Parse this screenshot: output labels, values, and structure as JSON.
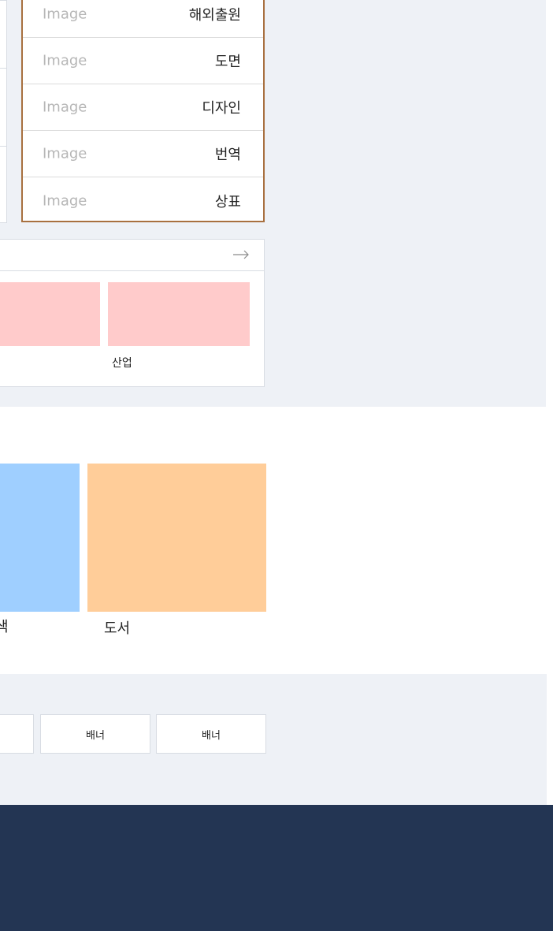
{
  "category_list": {
    "items": [
      {
        "image": "Image",
        "label": "해외출원"
      },
      {
        "image": "Image",
        "label": "도면"
      },
      {
        "image": "Image",
        "label": "디자인"
      },
      {
        "image": "Image",
        "label": "번역"
      },
      {
        "image": "Image",
        "label": "상표"
      }
    ]
  },
  "industry_card": {
    "label": "산업",
    "arrow_icon": "arrow-right-icon"
  },
  "featured": {
    "partial_label": "색",
    "books_label": "도서"
  },
  "banners": [
    "배너",
    "배너",
    "배너"
  ],
  "colors": {
    "section_bg": "#eef1f6",
    "accent_border": "#a8703f",
    "pink_placeholder": "#ffcbcb",
    "blue_placeholder": "#9fcfff",
    "orange_placeholder": "#ffcd99",
    "footer_bg": "#233553"
  }
}
